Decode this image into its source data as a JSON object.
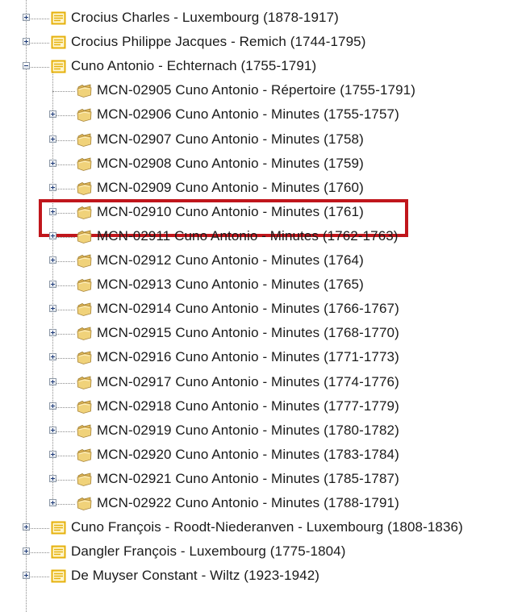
{
  "colors": {
    "highlight_border": "#c0161c",
    "record_icon": "#e6b10c",
    "folder_icon": "#f0d27a",
    "tree_lines": "#8c8c8c"
  },
  "icons": {
    "expand": "plus-box-icon",
    "collapse": "minus-box-icon",
    "record": "record-folder-icon",
    "volume": "open-folder-icon"
  },
  "tree": {
    "items": [
      {
        "label": "Crocius Charles - Luxembourg (1878-1917)",
        "level": 1,
        "kind": "record",
        "expander": "plus"
      },
      {
        "label": "Crocius Philippe Jacques - Remich (1744-1795)",
        "level": 1,
        "kind": "record",
        "expander": "plus"
      },
      {
        "label": "Cuno Antonio - Echternach (1755-1791)",
        "level": 1,
        "kind": "record",
        "expander": "minus"
      },
      {
        "label": "MCN-02905 Cuno Antonio - Répertoire (1755-1791)",
        "level": 2,
        "kind": "folder",
        "expander": "none"
      },
      {
        "label": "MCN-02906 Cuno Antonio - Minutes (1755-1757)",
        "level": 2,
        "kind": "folder",
        "expander": "plus"
      },
      {
        "label": "MCN-02907 Cuno Antonio - Minutes (1758)",
        "level": 2,
        "kind": "folder",
        "expander": "plus"
      },
      {
        "label": "MCN-02908 Cuno Antonio - Minutes (1759)",
        "level": 2,
        "kind": "folder",
        "expander": "plus"
      },
      {
        "label": "MCN-02909 Cuno Antonio - Minutes (1760)",
        "level": 2,
        "kind": "folder",
        "expander": "plus"
      },
      {
        "label": "MCN-02910 Cuno Antonio - Minutes (1761)",
        "level": 2,
        "kind": "folder",
        "expander": "plus",
        "highlighted": true
      },
      {
        "label": "MCN-02911 Cuno Antonio - Minutes (1762-1763)",
        "level": 2,
        "kind": "folder",
        "expander": "plus"
      },
      {
        "label": "MCN-02912 Cuno Antonio - Minutes (1764)",
        "level": 2,
        "kind": "folder",
        "expander": "plus"
      },
      {
        "label": "MCN-02913 Cuno Antonio - Minutes (1765)",
        "level": 2,
        "kind": "folder",
        "expander": "plus"
      },
      {
        "label": "MCN-02914 Cuno Antonio - Minutes (1766-1767)",
        "level": 2,
        "kind": "folder",
        "expander": "plus"
      },
      {
        "label": "MCN-02915 Cuno Antonio - Minutes (1768-1770)",
        "level": 2,
        "kind": "folder",
        "expander": "plus"
      },
      {
        "label": "MCN-02916 Cuno Antonio - Minutes (1771-1773)",
        "level": 2,
        "kind": "folder",
        "expander": "plus"
      },
      {
        "label": "MCN-02917 Cuno Antonio - Minutes (1774-1776)",
        "level": 2,
        "kind": "folder",
        "expander": "plus"
      },
      {
        "label": "MCN-02918 Cuno Antonio - Minutes (1777-1779)",
        "level": 2,
        "kind": "folder",
        "expander": "plus"
      },
      {
        "label": "MCN-02919 Cuno Antonio - Minutes (1780-1782)",
        "level": 2,
        "kind": "folder",
        "expander": "plus"
      },
      {
        "label": "MCN-02920 Cuno Antonio - Minutes (1783-1784)",
        "level": 2,
        "kind": "folder",
        "expander": "plus"
      },
      {
        "label": "MCN-02921 Cuno Antonio - Minutes (1785-1787)",
        "level": 2,
        "kind": "folder",
        "expander": "plus"
      },
      {
        "label": "MCN-02922 Cuno Antonio - Minutes (1788-1791)",
        "level": 2,
        "kind": "folder",
        "expander": "plus"
      },
      {
        "label": "Cuno François - Roodt-Niederanven - Luxembourg (1808-1836)",
        "level": 1,
        "kind": "record",
        "expander": "plus"
      },
      {
        "label": "Dangler François - Luxembourg (1775-1804)",
        "level": 1,
        "kind": "record",
        "expander": "plus"
      },
      {
        "label": "De Muyser Constant - Wiltz (1923-1942)",
        "level": 1,
        "kind": "record",
        "expander": "plus"
      }
    ]
  }
}
